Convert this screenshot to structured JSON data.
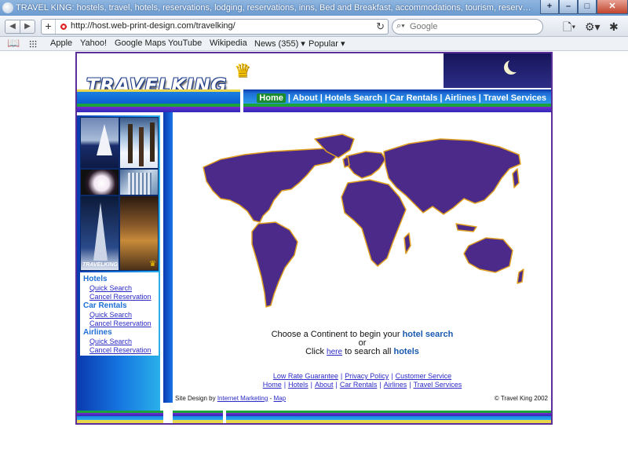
{
  "browser": {
    "window_title": "TRAVEL KING: hostels, travel, hotels, reservations, lodging, reservations, inns, Bed and Breakfast, accommodations, tourism, reservations, destinations, vacatio...",
    "url": "http://host.web-print-design.com/travelking/",
    "search_placeholder": "Google",
    "bookmarks": [
      "Apple",
      "Yahoo!",
      "Google Maps",
      "YouTube",
      "Wikipedia",
      "News (355) ▾",
      "Popular ▾"
    ]
  },
  "site": {
    "logo_text": "TRAVELKING",
    "nav": [
      "Home",
      "About",
      "Hotels Search",
      "Car Rentals",
      "Airlines",
      "Travel Services"
    ],
    "sidebar_mini_logo": "TRAVELKING",
    "sidemenu": [
      {
        "heading": "Hotels",
        "items": [
          "Quick Search",
          "Cancel Reservation"
        ]
      },
      {
        "heading": "Car Rentals",
        "items": [
          "Quick Search",
          "Cancel Reservation"
        ]
      },
      {
        "heading": "Airlines",
        "items": [
          "Quick Search",
          "Cancel Reservation"
        ]
      }
    ],
    "prompt": {
      "line1_pre": "Choose a Continent to begin your",
      "line1_link": "hotel search",
      "or": "or",
      "click": "Click",
      "here": "here",
      "to_search": "to search all",
      "hotels": "hotels"
    },
    "footer_links_1": [
      "Low Rate Guarantee",
      "Privacy Policy",
      "Customer Service"
    ],
    "footer_links_2": [
      "Home",
      "Hotels",
      "About",
      "Car Rentals",
      "Airlines",
      "Travel Services"
    ],
    "credit_pre": "Site Design by",
    "credit_link": "Internet Marketing",
    "credit_sep": "-",
    "map_link": "Map",
    "copyright": "© Travel King 2002"
  },
  "colors": {
    "page_border": "#5a2f9a",
    "continent_fill": "#4b2a8a",
    "continent_outline": "#e0a020",
    "link": "#2a2ac8"
  }
}
